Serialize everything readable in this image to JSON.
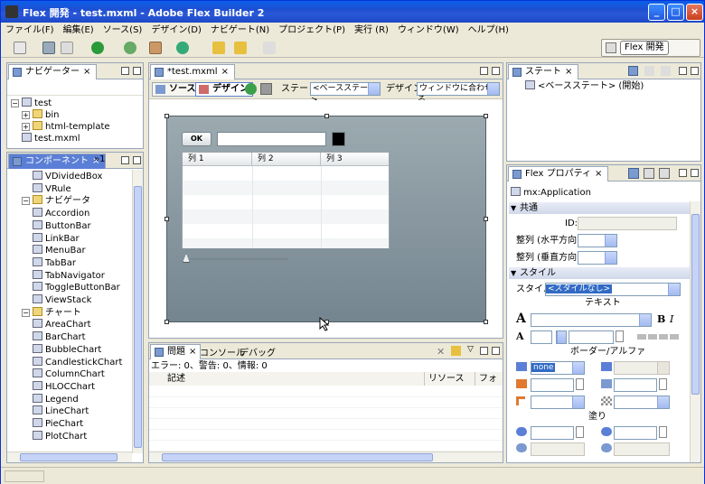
{
  "window": {
    "title": "Flex 開発 - test.mxml - Adobe Flex Builder 2"
  },
  "menu": [
    "ファイル(F)",
    "編集(E)",
    "ソース(S)",
    "デザイン(D)",
    "ナビゲート(N)",
    "プロジェクト(P)",
    "実行 (R)",
    "ウィンドウ(W)",
    "ヘルプ(H)"
  ],
  "perspective": {
    "label": "Flex 開発"
  },
  "navigator": {
    "tab": "ナビゲーター",
    "tree": [
      {
        "label": "test",
        "depth": 0,
        "kind": "project",
        "expander": "−"
      },
      {
        "label": "bin",
        "depth": 1,
        "kind": "folder",
        "expander": "+"
      },
      {
        "label": "html-template",
        "depth": 1,
        "kind": "folder",
        "expander": "+"
      },
      {
        "label": "test.mxml",
        "depth": 1,
        "kind": "file",
        "expander": ""
      }
    ]
  },
  "components": {
    "tab": "コンポーネント",
    "overflow": "»1",
    "items": [
      {
        "label": "VDividedBox",
        "depth": 2,
        "kind": "item"
      },
      {
        "label": "VRule",
        "depth": 2,
        "kind": "item"
      },
      {
        "label": "ナビゲータ",
        "depth": 1,
        "kind": "folder",
        "expander": "−"
      },
      {
        "label": "Accordion",
        "depth": 2,
        "kind": "item"
      },
      {
        "label": "ButtonBar",
        "depth": 2,
        "kind": "item"
      },
      {
        "label": "LinkBar",
        "depth": 2,
        "kind": "item"
      },
      {
        "label": "MenuBar",
        "depth": 2,
        "kind": "item"
      },
      {
        "label": "TabBar",
        "depth": 2,
        "kind": "item"
      },
      {
        "label": "TabNavigator",
        "depth": 2,
        "kind": "item"
      },
      {
        "label": "ToggleButtonBar",
        "depth": 2,
        "kind": "item"
      },
      {
        "label": "ViewStack",
        "depth": 2,
        "kind": "item"
      },
      {
        "label": "チャート",
        "depth": 1,
        "kind": "folder",
        "expander": "−"
      },
      {
        "label": "AreaChart",
        "depth": 2,
        "kind": "item"
      },
      {
        "label": "BarChart",
        "depth": 2,
        "kind": "item"
      },
      {
        "label": "BubbleChart",
        "depth": 2,
        "kind": "item"
      },
      {
        "label": "CandlestickChart",
        "depth": 2,
        "kind": "item"
      },
      {
        "label": "ColumnChart",
        "depth": 2,
        "kind": "item"
      },
      {
        "label": "HLOCChart",
        "depth": 2,
        "kind": "item"
      },
      {
        "label": "Legend",
        "depth": 2,
        "kind": "item"
      },
      {
        "label": "LineChart",
        "depth": 2,
        "kind": "item"
      },
      {
        "label": "PieChart",
        "depth": 2,
        "kind": "item"
      },
      {
        "label": "PlotChart",
        "depth": 2,
        "kind": "item"
      }
    ]
  },
  "editor": {
    "tab": "*test.mxml",
    "source_label": "ソース",
    "design_label": "デザイン",
    "state_label": "ステート:",
    "state_value": "<ベースステート>",
    "design_size_label": "デザイン:",
    "design_size_value": "ウィンドウに合わせる",
    "canvas": {
      "button_label": "OK",
      "columns": [
        "列 1",
        "列 2",
        "列 3"
      ]
    }
  },
  "problems": {
    "tabs": [
      "問題",
      "コンソール",
      "デバッグ"
    ],
    "summary": "エラー: 0、警告: 0、情報: 0",
    "columns": [
      "記述",
      "リソース",
      "フォル"
    ]
  },
  "states": {
    "tab": "ステート",
    "item": "<ベースステート> (開始)"
  },
  "props": {
    "tab": "Flex プロパティ",
    "component": "mx:Application",
    "sec_common": "共通",
    "id_label": "ID:",
    "halign_label": "整列 (水平方向):",
    "valign_label": "整列 (垂直方向):",
    "sec_style": "スタイル",
    "style_label": "スタイル:",
    "style_value": "<スタイルなし>",
    "text_label": "テキスト",
    "border_label": "ボーダー/アルファ",
    "border_value": "none",
    "fill_label": "塗り"
  },
  "colors": {
    "title_blue": "#1f4fd1",
    "canvas_top": "#9caab0",
    "canvas_bottom": "#758590",
    "tab_active": "#5b7fd6"
  }
}
